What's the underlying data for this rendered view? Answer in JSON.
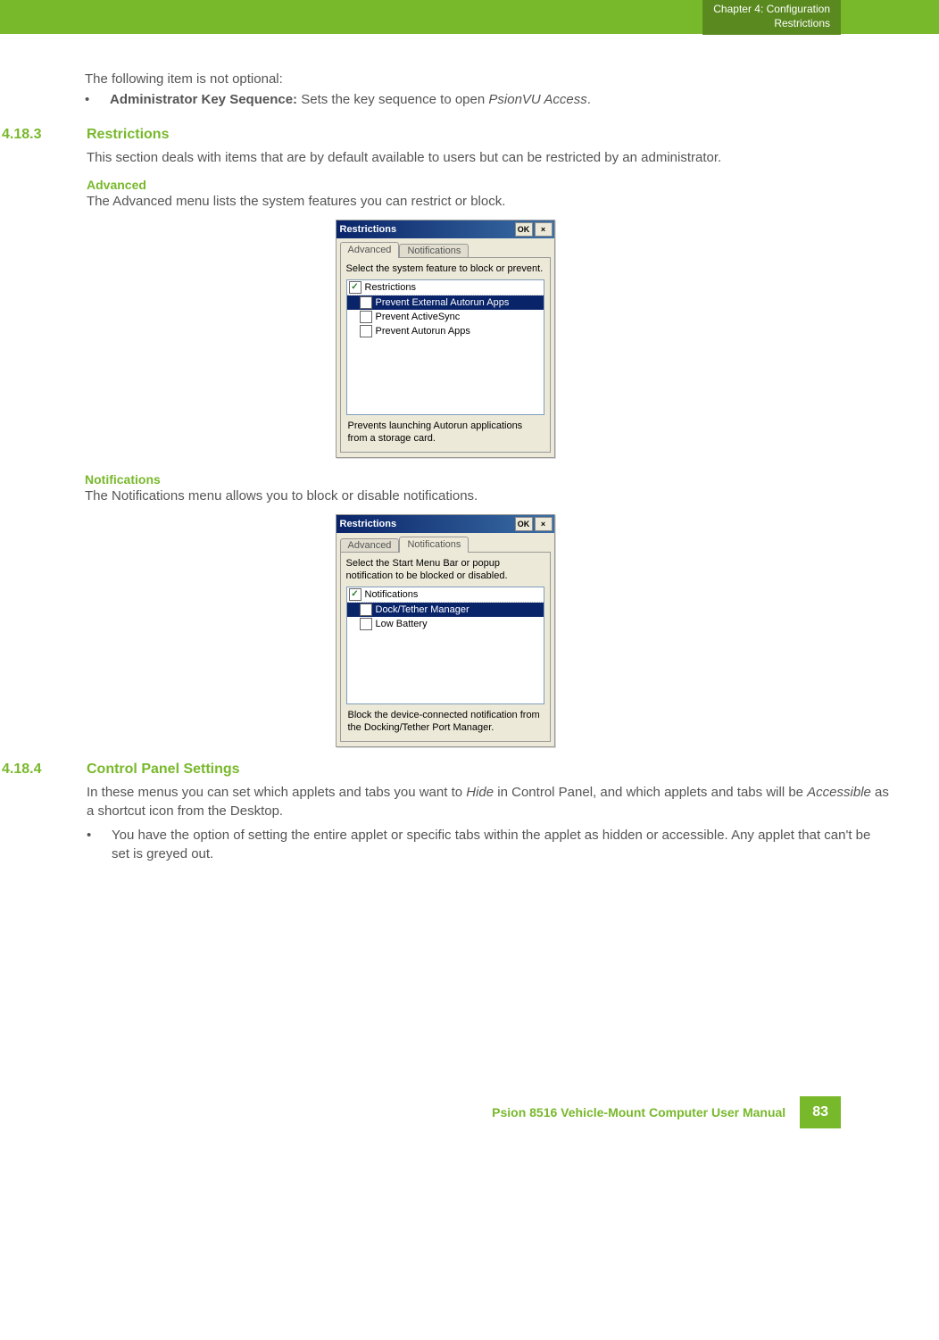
{
  "header": {
    "chapter_line": "Chapter 4:  Configuration",
    "sub_line": "Restrictions"
  },
  "intro": {
    "line": "The following item is not optional:",
    "bullet_bold": "Administrator Key Sequence:",
    "bullet_rest": " Sets the key sequence to open ",
    "bullet_italic": "PsionVU Access",
    "bullet_end": "."
  },
  "sec1": {
    "num": "4.18.3",
    "title": "Restrictions",
    "desc": "This section deals with items that are by default available to users but can be restricted by an administrator.",
    "adv_h": "Advanced",
    "adv_desc": "The Advanced menu lists the system features you can restrict or block.",
    "not_h": "Notifications",
    "not_desc": "The Notifications menu allows you to block or disable notifications."
  },
  "dialog1": {
    "title": "Restrictions",
    "ok": "OK",
    "close": "×",
    "tab_adv": "Advanced",
    "tab_not": "Notifications",
    "instr": "Select the system feature to block or prevent.",
    "hdr": "Restrictions",
    "item1": "Prevent External Autorun Apps",
    "item2": "Prevent ActiveSync",
    "item3": "Prevent Autorun Apps",
    "help": "Prevents launching Autorun applications from a storage card."
  },
  "dialog2": {
    "title": "Restrictions",
    "ok": "OK",
    "close": "×",
    "tab_adv": "Advanced",
    "tab_not": "Notifications",
    "instr": "Select the Start Menu Bar or popup notification to be blocked or disabled.",
    "hdr": "Notifications",
    "item1": "Dock/Tether Manager",
    "item2": "Low Battery",
    "help": "Block the device-connected notification from the Docking/Tether Port Manager."
  },
  "sec2": {
    "num": "4.18.4",
    "title": "Control Panel Settings",
    "p1a": "In these menus you can set which applets and tabs you want to ",
    "p1_i1": "Hide",
    "p1b": " in Control Panel, and which applets and tabs will be ",
    "p1_i2": "Accessible",
    "p1c": " as a shortcut icon from the Desktop.",
    "bullet": "You have the option of setting the entire applet or specific tabs within the applet as hidden or accessible. Any applet that can't be set is greyed out."
  },
  "footer": {
    "text": "Psion 8516 Vehicle-Mount Computer User Manual",
    "page": "83"
  }
}
